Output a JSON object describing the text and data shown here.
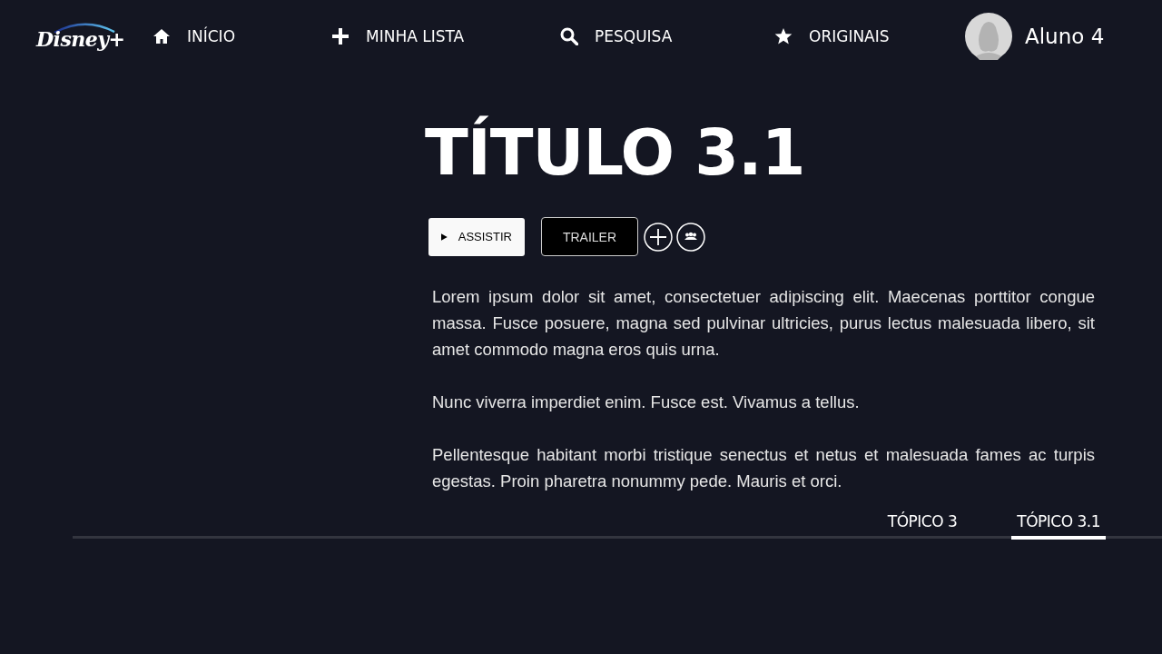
{
  "logo": "Disney+",
  "nav": [
    {
      "kind": "home",
      "label": "INÍCIO"
    },
    {
      "kind": "plus",
      "label": "MINHA LISTA"
    },
    {
      "kind": "search",
      "label": "PESQUISA"
    },
    {
      "kind": "star",
      "label": "ORIGINAIS"
    }
  ],
  "profile": {
    "name": "Aluno 4"
  },
  "title": "TÍTULO 3.1",
  "actions": {
    "play": "ASSISTIR",
    "trailer": "TRAILER"
  },
  "paragraphs": [
    "Lorem ipsum dolor sit amet, consectetuer adipiscing elit. Maecenas porttitor congue massa. Fusce posuere, magna sed pulvinar ultricies, purus lectus malesuada libero, sit amet commodo magna eros quis urna.",
    "Nunc viverra imperdiet enim. Fusce est. Vivamus a tellus.",
    "Pellentesque habitant morbi tristique senectus et netus et malesuada fames ac turpis egestas. Proin pharetra nonummy pede. Mauris et orci."
  ],
  "tabs": [
    {
      "label": "TÓPICO 3",
      "selected": false
    },
    {
      "label": "TÓPICO 3.1",
      "selected": true
    }
  ]
}
